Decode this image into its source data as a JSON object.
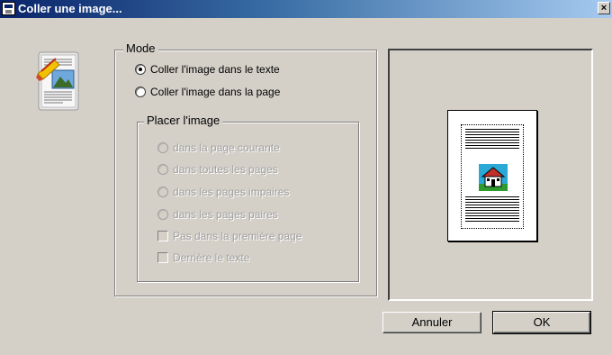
{
  "window": {
    "title": "Coller une image...",
    "close_label": "×"
  },
  "mode_group": {
    "legend": "Mode",
    "options": [
      {
        "label": "Coller l'image dans le texte",
        "checked": true
      },
      {
        "label": "Coller l'image dans la page",
        "checked": false
      }
    ]
  },
  "placement_group": {
    "legend": "Placer l'image",
    "radios": [
      {
        "label": "dans la page courante",
        "enabled": false
      },
      {
        "label": "dans toutes les pages",
        "enabled": false
      },
      {
        "label": "dans les pages impaires",
        "enabled": false
      },
      {
        "label": "dans les pages paires",
        "enabled": false
      }
    ],
    "checkboxes": [
      {
        "label": "Pas dans la première page",
        "enabled": false,
        "checked": false
      },
      {
        "label": "Derrière le texte",
        "enabled": false,
        "checked": false
      }
    ]
  },
  "buttons": {
    "cancel": "Annuler",
    "ok": "OK"
  },
  "icons": {
    "app": "newspaper-paste-icon",
    "preview_image": "house-icon"
  },
  "colors": {
    "titlebar_start": "#0a246a",
    "titlebar_end": "#a6caf0",
    "dialog_bg": "#d4d0c8"
  }
}
